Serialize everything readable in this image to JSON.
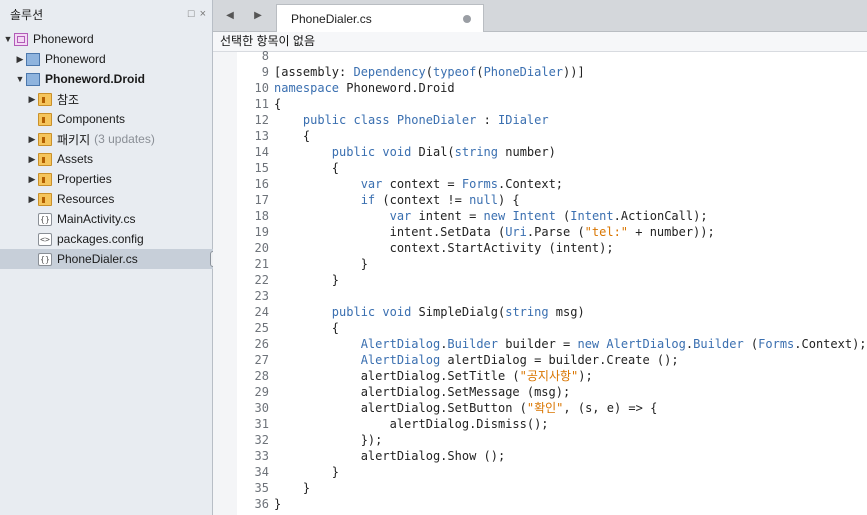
{
  "sidebar": {
    "title": "솔루션",
    "pin_icon": "□",
    "close_icon": "×",
    "tree": [
      {
        "label": "Phoneword",
        "icon": "solution-icon",
        "expanded": true,
        "bold": false
      },
      {
        "label": "Phoneword",
        "icon": "project-icon",
        "expanded": false,
        "bold": false
      },
      {
        "label": "Phoneword.Droid",
        "icon": "project-icon",
        "expanded": true,
        "bold": true
      },
      {
        "label": "참조",
        "icon": "folder-icon",
        "expanded": false
      },
      {
        "label": "Components",
        "icon": "folder-icon"
      },
      {
        "label": "패키지",
        "suffix": "(3 updates)",
        "icon": "folder-icon",
        "expanded": false
      },
      {
        "label": "Assets",
        "icon": "folder-icon",
        "expanded": false
      },
      {
        "label": "Properties",
        "icon": "folder-icon",
        "expanded": false
      },
      {
        "label": "Resources",
        "icon": "folder-icon",
        "expanded": false
      },
      {
        "label": "MainActivity.cs",
        "icon": "code-file-icon"
      },
      {
        "label": "packages.config",
        "icon": "config-file-icon"
      },
      {
        "label": "PhoneDialer.cs",
        "icon": "code-file-icon",
        "selected": true
      }
    ],
    "code_glyph": "{}",
    "config_glyph": "<>"
  },
  "editor": {
    "tab_label": "PhoneDialer.cs",
    "nav_back": "◀",
    "nav_forward": "▶",
    "path_text": "선택한 항목이 없음",
    "lines": [
      {
        "n": "8",
        "tokens": []
      },
      {
        "n": "9",
        "tokens": [
          {
            "t": "[assembly: ",
            "c": "pl"
          },
          {
            "t": "Dependency",
            "c": "ty"
          },
          {
            "t": "(",
            "c": "pl"
          },
          {
            "t": "typeof",
            "c": "kw"
          },
          {
            "t": "(",
            "c": "pl"
          },
          {
            "t": "PhoneDialer",
            "c": "ty"
          },
          {
            "t": "))]",
            "c": "pl"
          }
        ]
      },
      {
        "n": "10",
        "tokens": [
          {
            "t": "namespace",
            "c": "kw"
          },
          {
            "t": " Phoneword.Droid",
            "c": "pl"
          }
        ]
      },
      {
        "n": "11",
        "tokens": [
          {
            "t": "{",
            "c": "pl"
          }
        ]
      },
      {
        "n": "12",
        "tokens": [
          {
            "t": "    ",
            "c": "pl"
          },
          {
            "t": "public",
            "c": "kw"
          },
          {
            "t": " ",
            "c": "pl"
          },
          {
            "t": "class",
            "c": "kw"
          },
          {
            "t": " ",
            "c": "pl"
          },
          {
            "t": "PhoneDialer",
            "c": "ty"
          },
          {
            "t": " : ",
            "c": "pl"
          },
          {
            "t": "IDialer",
            "c": "ty"
          }
        ]
      },
      {
        "n": "13",
        "tokens": [
          {
            "t": "    {",
            "c": "pl"
          }
        ]
      },
      {
        "n": "14",
        "tokens": [
          {
            "t": "        ",
            "c": "pl"
          },
          {
            "t": "public",
            "c": "kw"
          },
          {
            "t": " ",
            "c": "pl"
          },
          {
            "t": "void",
            "c": "kw"
          },
          {
            "t": " Dial(",
            "c": "pl"
          },
          {
            "t": "string",
            "c": "kw"
          },
          {
            "t": " number)",
            "c": "pl"
          }
        ]
      },
      {
        "n": "15",
        "tokens": [
          {
            "t": "        {",
            "c": "pl"
          }
        ]
      },
      {
        "n": "16",
        "tokens": [
          {
            "t": "            ",
            "c": "pl"
          },
          {
            "t": "var",
            "c": "kw"
          },
          {
            "t": " context = ",
            "c": "pl"
          },
          {
            "t": "Forms",
            "c": "ty"
          },
          {
            "t": ".Context;",
            "c": "pl"
          }
        ]
      },
      {
        "n": "17",
        "tokens": [
          {
            "t": "            ",
            "c": "pl"
          },
          {
            "t": "if",
            "c": "kw"
          },
          {
            "t": " (context != ",
            "c": "pl"
          },
          {
            "t": "null",
            "c": "kw"
          },
          {
            "t": ") {",
            "c": "pl"
          }
        ]
      },
      {
        "n": "18",
        "tokens": [
          {
            "t": "                ",
            "c": "pl"
          },
          {
            "t": "var",
            "c": "kw"
          },
          {
            "t": " intent = ",
            "c": "pl"
          },
          {
            "t": "new",
            "c": "kw"
          },
          {
            "t": " ",
            "c": "pl"
          },
          {
            "t": "Intent",
            "c": "ty"
          },
          {
            "t": " (",
            "c": "pl"
          },
          {
            "t": "Intent",
            "c": "ty"
          },
          {
            "t": ".ActionCall);",
            "c": "pl"
          }
        ]
      },
      {
        "n": "19",
        "tokens": [
          {
            "t": "                intent.SetData (",
            "c": "pl"
          },
          {
            "t": "Uri",
            "c": "ty"
          },
          {
            "t": ".Parse (",
            "c": "pl"
          },
          {
            "t": "\"tel:\"",
            "c": "st"
          },
          {
            "t": " + number));",
            "c": "pl"
          }
        ]
      },
      {
        "n": "20",
        "tokens": [
          {
            "t": "                context.StartActivity (intent);",
            "c": "pl"
          }
        ]
      },
      {
        "n": "21",
        "tokens": [
          {
            "t": "            }",
            "c": "pl"
          }
        ]
      },
      {
        "n": "22",
        "tokens": [
          {
            "t": "        }",
            "c": "pl"
          }
        ]
      },
      {
        "n": "23",
        "tokens": []
      },
      {
        "n": "24",
        "tokens": [
          {
            "t": "        ",
            "c": "pl"
          },
          {
            "t": "public",
            "c": "kw"
          },
          {
            "t": " ",
            "c": "pl"
          },
          {
            "t": "void",
            "c": "kw"
          },
          {
            "t": " SimpleDialg(",
            "c": "pl"
          },
          {
            "t": "string",
            "c": "kw"
          },
          {
            "t": " msg)",
            "c": "pl"
          }
        ]
      },
      {
        "n": "25",
        "tokens": [
          {
            "t": "        {",
            "c": "pl"
          }
        ]
      },
      {
        "n": "26",
        "tokens": [
          {
            "t": "            ",
            "c": "pl"
          },
          {
            "t": "AlertDialog",
            "c": "ty"
          },
          {
            "t": ".",
            "c": "pl"
          },
          {
            "t": "Builder",
            "c": "ty"
          },
          {
            "t": " builder = ",
            "c": "pl"
          },
          {
            "t": "new",
            "c": "kw"
          },
          {
            "t": " ",
            "c": "pl"
          },
          {
            "t": "AlertDialog",
            "c": "ty"
          },
          {
            "t": ".",
            "c": "pl"
          },
          {
            "t": "Builder",
            "c": "ty"
          },
          {
            "t": " (",
            "c": "pl"
          },
          {
            "t": "Forms",
            "c": "ty"
          },
          {
            "t": ".Context);",
            "c": "pl"
          }
        ]
      },
      {
        "n": "27",
        "tokens": [
          {
            "t": "            ",
            "c": "pl"
          },
          {
            "t": "AlertDialog",
            "c": "ty"
          },
          {
            "t": " alertDialog = builder.Create ();",
            "c": "pl"
          }
        ]
      },
      {
        "n": "28",
        "tokens": [
          {
            "t": "            alertDialog.SetTitle (",
            "c": "pl"
          },
          {
            "t": "\"공지사항\"",
            "c": "st"
          },
          {
            "t": ");",
            "c": "pl"
          }
        ]
      },
      {
        "n": "29",
        "tokens": [
          {
            "t": "            alertDialog.SetMessage (msg);",
            "c": "pl"
          }
        ]
      },
      {
        "n": "30",
        "tokens": [
          {
            "t": "            alertDialog.SetButton (",
            "c": "pl"
          },
          {
            "t": "\"확인\"",
            "c": "st"
          },
          {
            "t": ", (s, e) => {",
            "c": "pl"
          }
        ]
      },
      {
        "n": "31",
        "tokens": [
          {
            "t": "                alertDialog.Dismiss();",
            "c": "pl"
          }
        ]
      },
      {
        "n": "32",
        "tokens": [
          {
            "t": "            });",
            "c": "pl"
          }
        ]
      },
      {
        "n": "33",
        "tokens": [
          {
            "t": "            alertDialog.Show ();",
            "c": "pl"
          }
        ]
      },
      {
        "n": "34",
        "tokens": [
          {
            "t": "        }",
            "c": "pl"
          }
        ]
      },
      {
        "n": "35",
        "tokens": [
          {
            "t": "    }",
            "c": "pl"
          }
        ]
      },
      {
        "n": "36",
        "tokens": [
          {
            "t": "}",
            "c": "pl"
          }
        ]
      }
    ]
  }
}
